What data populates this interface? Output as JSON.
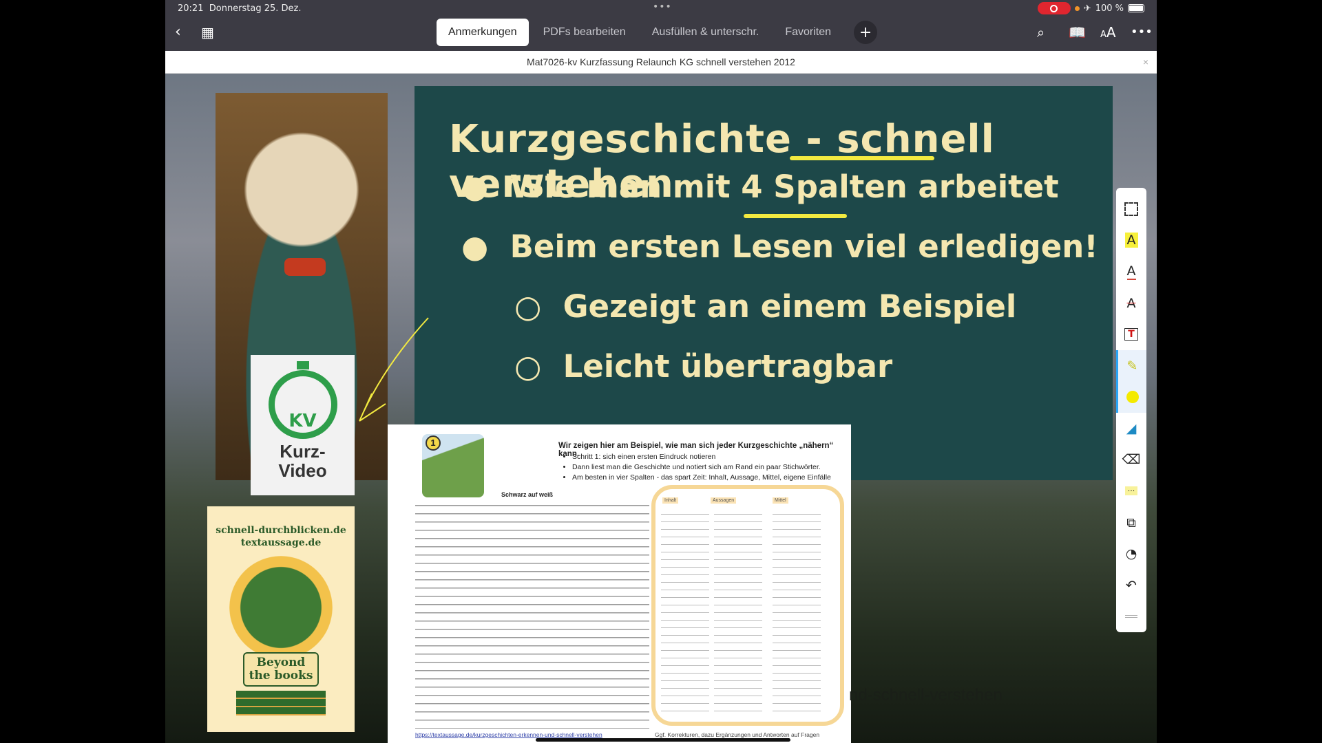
{
  "status": {
    "time": "20:21",
    "date": "Donnerstag 25. Dez.",
    "battery": "100 %"
  },
  "toolbar": {
    "tabs": [
      {
        "label": "Anmerkungen",
        "active": true
      },
      {
        "label": "PDFs bearbeiten"
      },
      {
        "label": "Ausfüllen & unterschr."
      },
      {
        "label": "Favoriten"
      }
    ],
    "add": "+"
  },
  "document": {
    "title": "Mat7026-kv Kurzfassung Relaunch KG schnell verstehen 2012",
    "close": "×"
  },
  "slide": {
    "title": "Kurzgeschichte - schnell verstehen",
    "bullets": [
      "Wie man mit 4 Spalten arbeitet",
      "Beim ersten Lesen viel erledigen!"
    ],
    "subbullets": [
      "Gezeigt an einem Beispiel",
      "Leicht übertragbar"
    ]
  },
  "kv_badge": {
    "icon_text": "KV",
    "label1": "Kurz-",
    "label2": "Video"
  },
  "book": {
    "line1": "schnell-durchblicken.de",
    "line2": "textaussage.de",
    "logo_text": "Beyond the books"
  },
  "page": {
    "step": "1",
    "heading": "Wir zeigen hier am Beispiel, wie man sich jeder Kurzgeschichte „nähern“ kann.",
    "items": [
      "Schritt 1: sich einen ersten Eindruck notieren",
      "Dann liest man die Geschichte und notiert sich am Rand ein paar Stichwörter.",
      "Am besten in vier Spalten - das spart Zeit: Inhalt, Aussage, Mittel, eigene Einfälle"
    ],
    "story_title": "Schwarz auf weiß",
    "columns": [
      "Inhalt",
      "Aussagen",
      "Mittel"
    ],
    "link": "https://textaussage.de/kurzgeschichten-erkennen-und-schnell-verstehen",
    "footer": "Ggf. Korrekturen, dazu Ergänzungen und Antworten auf Fragen"
  },
  "overlay_text": "nd-schnell-verstehen",
  "annotation_tools": [
    "select-rect",
    "highlight-text",
    "underline-text",
    "strikethrough-text",
    "text-box",
    "highlighter-pen",
    "color-yellow",
    "marker",
    "eraser",
    "comment",
    "shapes",
    "sticker",
    "undo",
    "handle"
  ],
  "colors": {
    "slide_bg": "#1d4849",
    "slide_text": "#f4e7b0",
    "highlight": "#f3ea40",
    "active_tool": "#2aa4f4"
  }
}
